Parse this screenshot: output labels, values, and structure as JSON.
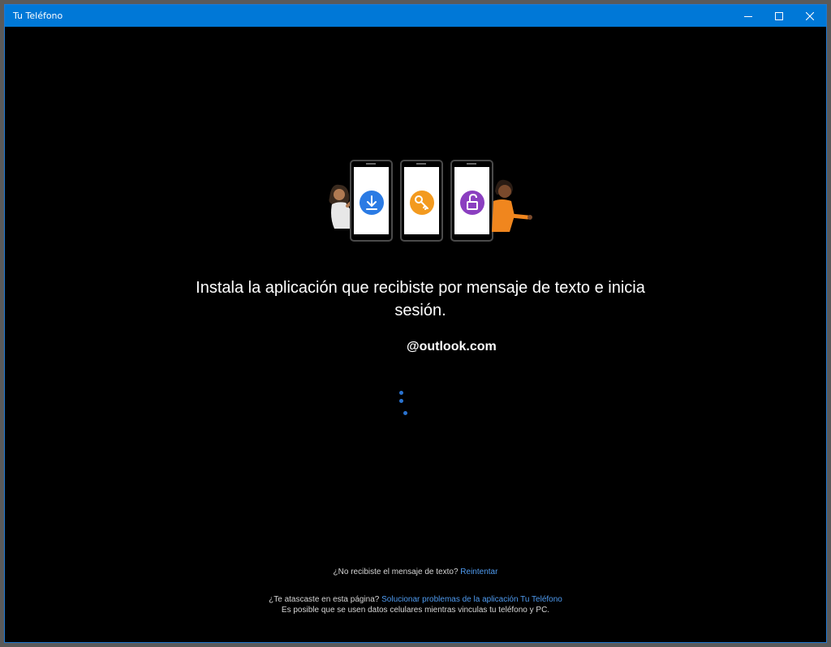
{
  "window": {
    "title": "Tu Teléfono",
    "accent_color": "#0078d7"
  },
  "titlebar": {
    "minimize_icon": "minimize-icon",
    "maximize_icon": "maximize-icon",
    "close_icon": "close-icon"
  },
  "illustration": {
    "phone_icons": [
      "download-icon",
      "key-icon",
      "unlock-icon"
    ],
    "icon_colors": [
      "#2b7be4",
      "#f39a1f",
      "#8b3fc0"
    ]
  },
  "main": {
    "heading": "Instala la aplicación que recibiste por mensaje de texto e inicia sesión.",
    "account_domain": "@outlook.com",
    "spinner_color": "#2a73d0"
  },
  "footer": {
    "no_text_question": "¿No recibiste el mensaje de texto?",
    "retry_link": "Reintentar",
    "stuck_question": "¿Te atascaste en esta página?",
    "troubleshoot_link": "Solucionar problemas de la aplicación Tu Teléfono",
    "data_notice": "Es posible que se usen datos celulares mientras vinculas tu teléfono y PC."
  }
}
